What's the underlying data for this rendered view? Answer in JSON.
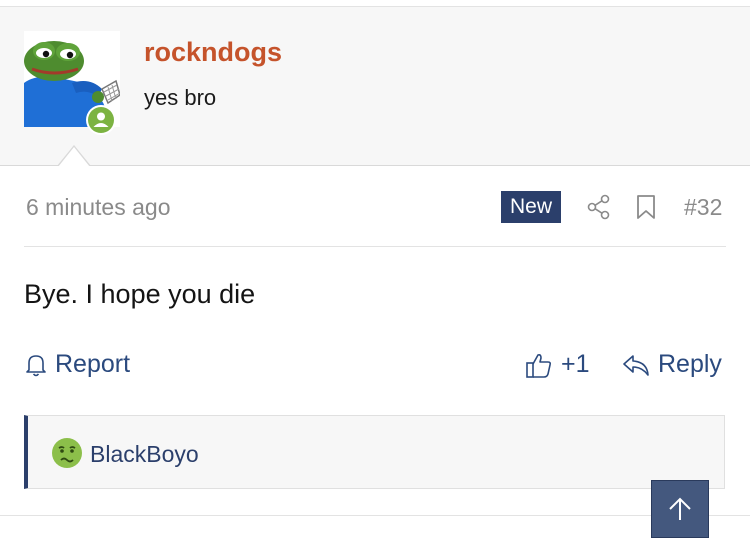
{
  "post_header": {
    "username": "rockndogs",
    "user_title": "yes bro"
  },
  "post_meta": {
    "timestamp": "6 minutes ago",
    "new_badge": "New",
    "post_number": "#32"
  },
  "post_body": {
    "text": "Bye. I hope you die"
  },
  "actions": {
    "report_label": "Report",
    "like_count": "+1",
    "reply_label": "Reply"
  },
  "reactions": {
    "user": "BlackBoyo",
    "emoji": "nauseated-face-icon"
  },
  "colors": {
    "username": "#c5532b",
    "accent_navy": "#2b3f6b",
    "link_blue": "#2b4a7e",
    "online_green": "#7cb342",
    "header_bg": "#f7f7f7"
  },
  "icons": [
    "user-online-icon",
    "share-icon",
    "bookmark-icon",
    "bell-icon",
    "thumbs-up-icon",
    "reply-arrow-icon",
    "arrow-up-icon"
  ]
}
